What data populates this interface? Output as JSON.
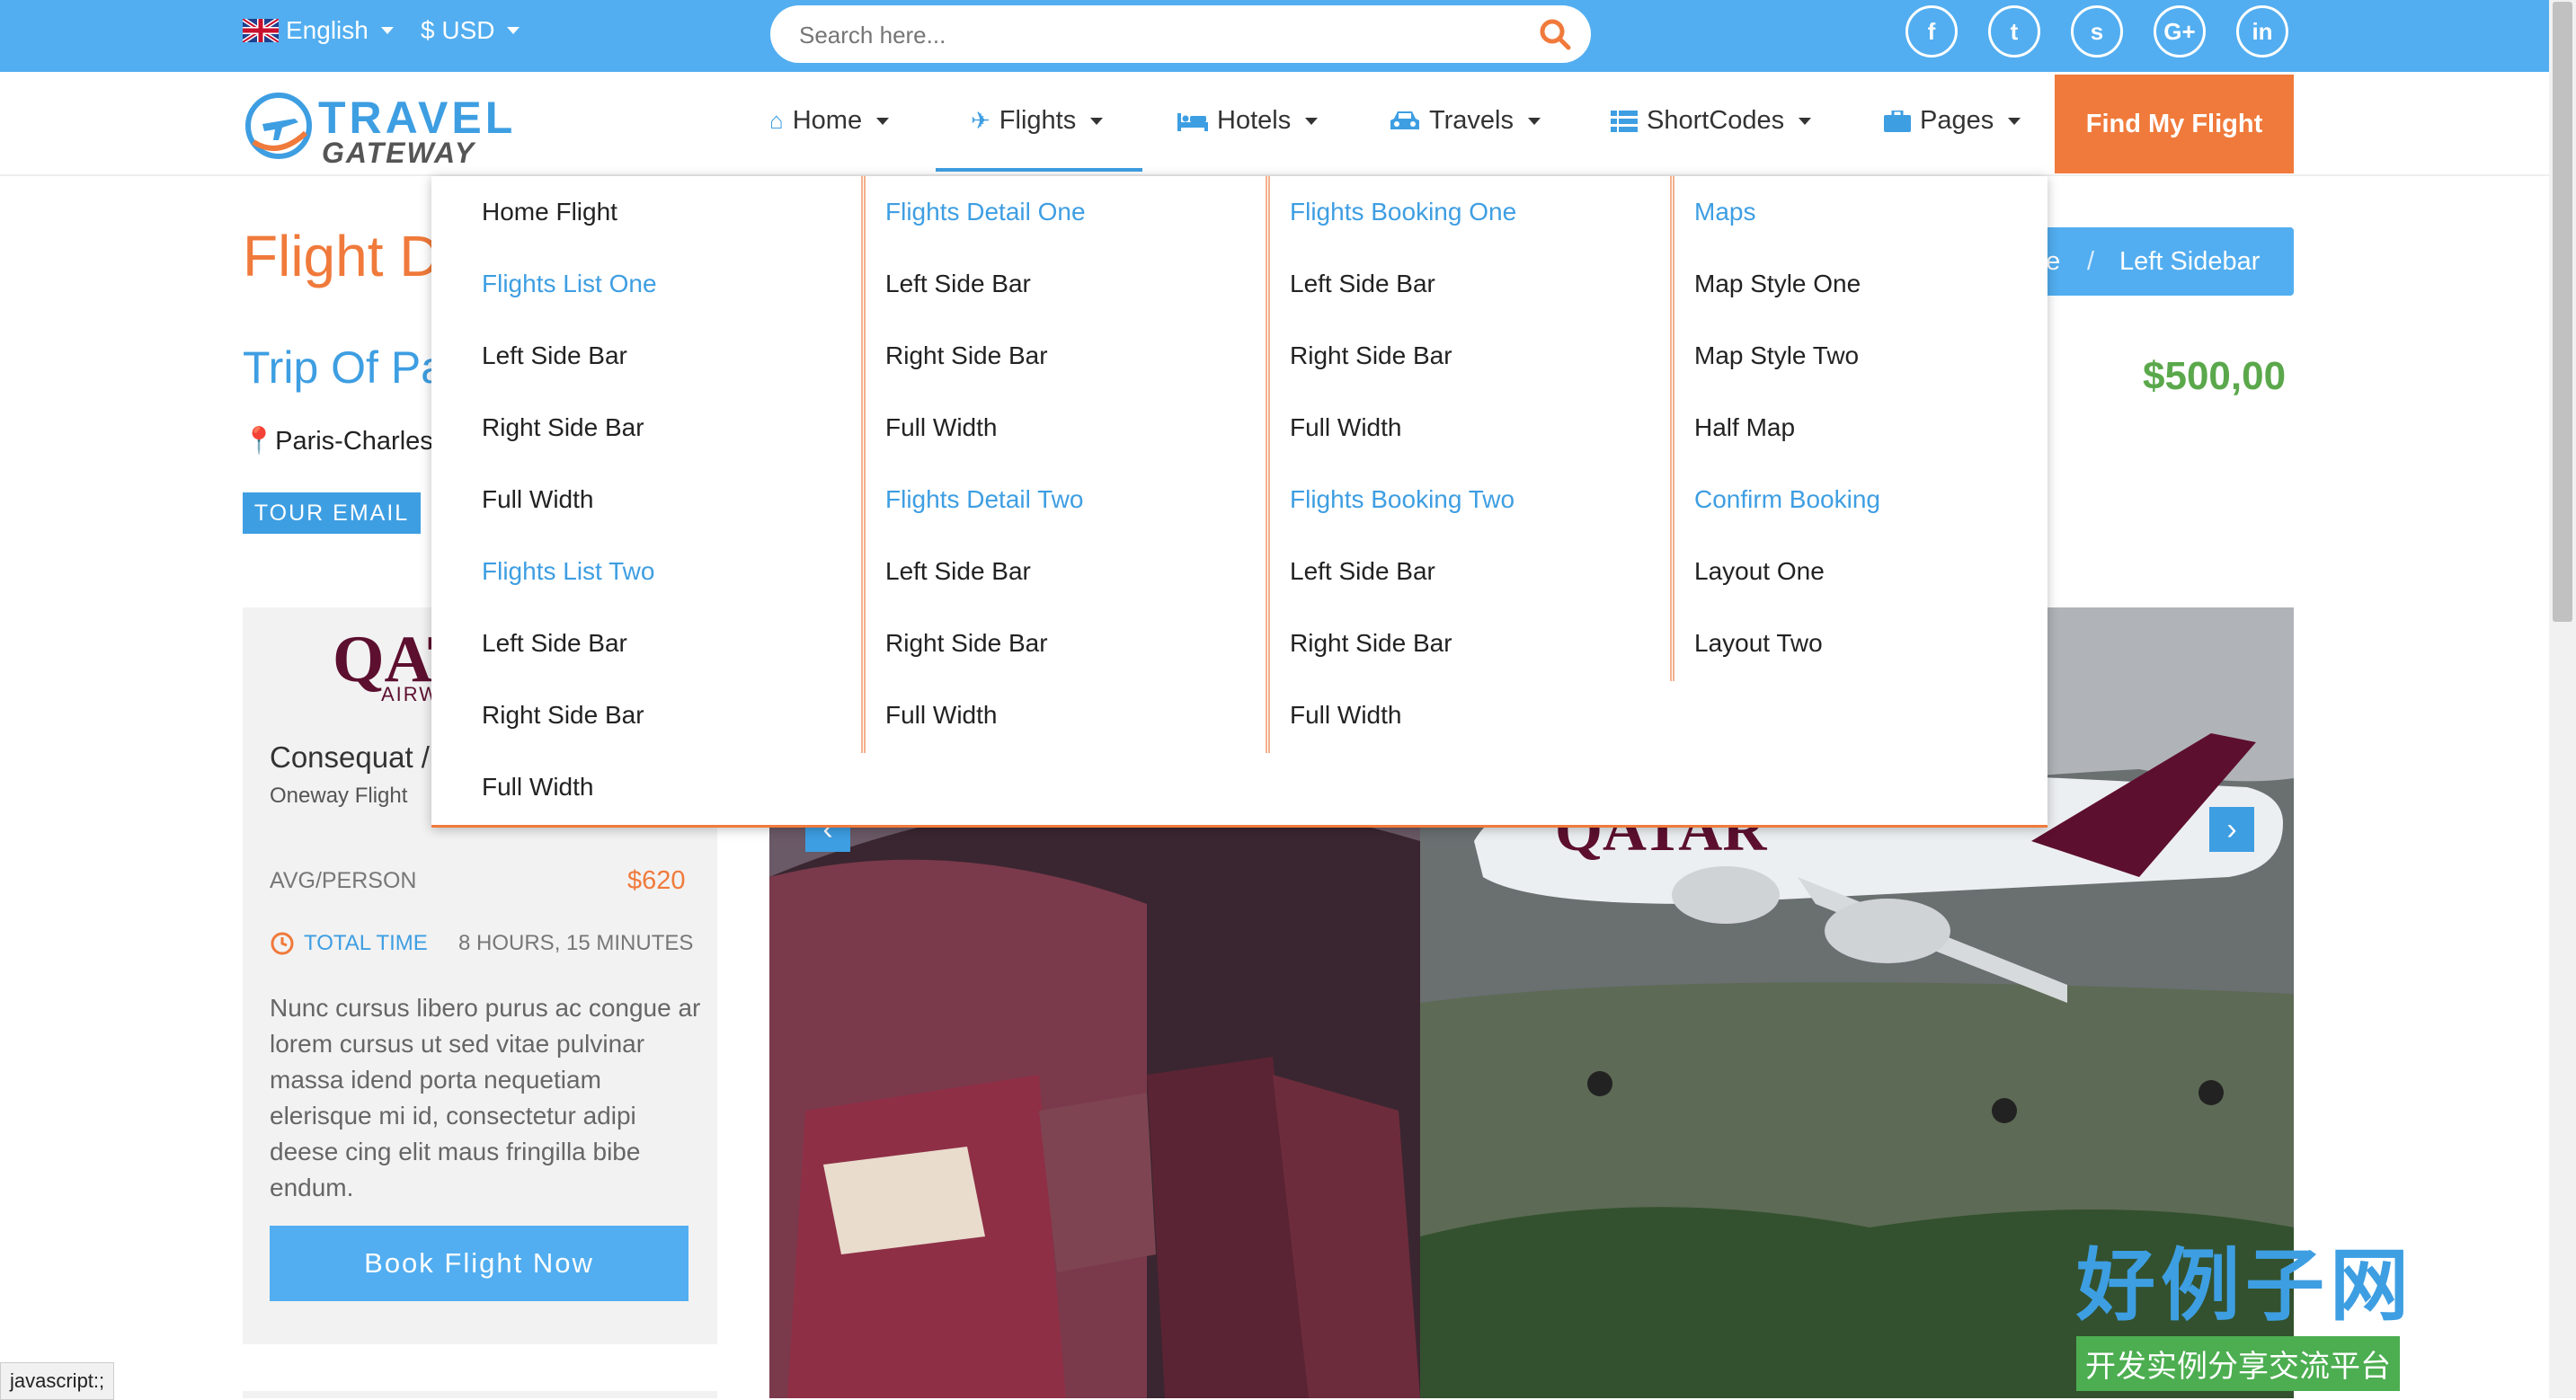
{
  "topbar": {
    "language": "English",
    "currency": "$ USD",
    "search_placeholder": "Search here...",
    "social": [
      "f",
      "t",
      "s",
      "G+",
      "in"
    ]
  },
  "logo": {
    "line1": "TRAVEL",
    "line2": "GATEWAY"
  },
  "nav": {
    "items": [
      "Home",
      "Flights",
      "Hotels",
      "Travels",
      "ShortCodes",
      "Pages"
    ],
    "cta": "Find My Flight"
  },
  "mega_menu": {
    "col1": [
      "Home Flight",
      "Flights List One",
      "Left Side Bar",
      "Right Side Bar",
      "Full Width",
      "Flights List Two",
      "Left Side Bar",
      "Right Side Bar",
      "Full Width"
    ],
    "col2": [
      "Flights Detail One",
      "Left Side Bar",
      "Right Side Bar",
      "Full Width",
      "Flights Detail Two",
      "Left Side Bar",
      "Right Side Bar",
      "Full Width"
    ],
    "col3": [
      "Flights Booking One",
      "Left Side Bar",
      "Right Side Bar",
      "Full Width",
      "Flights Booking Two",
      "Left Side Bar",
      "Right Side Bar",
      "Full Width"
    ],
    "col4": [
      "Maps",
      "Map Style One",
      "Map Style Two",
      "Half Map",
      "Confirm Booking",
      "Layout One",
      "Layout Two"
    ]
  },
  "page": {
    "title": "Flight D",
    "trip_title": "Trip Of Pa",
    "location": "Paris-Charles",
    "tour_email": "TOUR EMAIL",
    "breadcrumb_home": "ne",
    "breadcrumb_sep": "/",
    "breadcrumb_current": "Left Sidebar",
    "price": "$500,00"
  },
  "card": {
    "logo_main": "QAT",
    "logo_sub": "AIRW",
    "title": "Consequat /",
    "subtitle": "Oneway Flight",
    "avg_label": "AVG/PERSON",
    "avg_value": "$620",
    "time_label": "TOTAL TIME",
    "time_value": "8 HOURS, 15 MINUTES",
    "description": "Nunc cursus libero purus ac congue ar lorem cursus ut sed vitae pulvinar massa idend porta nequetiam elerisque mi id, consectetur adipi deese cing elit maus fringilla bibe endum.",
    "book_button": "Book Flight Now"
  },
  "slider": {
    "plane_livery": "QATAR"
  },
  "status_bar": "javascript:;",
  "watermark": {
    "big": "好例子网",
    "small": "开发实例分享交流平台"
  },
  "colors": {
    "primary": "#52aef0",
    "accent": "#f07a3b",
    "price": "#5aa84b"
  }
}
